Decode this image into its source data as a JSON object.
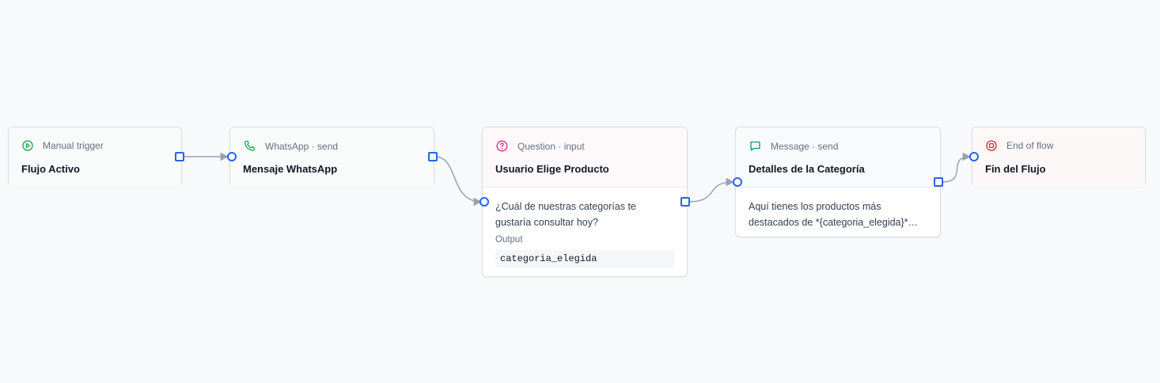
{
  "nodes": [
    {
      "id": "n1",
      "kind": "Manual trigger",
      "title": "Flujo Activo",
      "icon": "play-circle-icon",
      "accent": "#16a34a"
    },
    {
      "id": "n2",
      "kind": "WhatsApp · send",
      "title": "Mensaje WhatsApp",
      "icon": "phone-icon",
      "accent": "#16a34a"
    },
    {
      "id": "n3",
      "kind": "Question · input",
      "title": "Usuario Elige Producto",
      "icon": "question-circle-icon",
      "accent": "#db2777",
      "body": "¿Cuál de nuestras categorías te gustaría consultar hoy?",
      "output_label": "Output",
      "output_value": "categoria_elegida"
    },
    {
      "id": "n4",
      "kind": "Message · send",
      "title": "Detalles de la Categoría",
      "icon": "chat-bubble-icon",
      "accent": "#0d9488",
      "body": "Aquí tienes los productos más destacados de *{categoria_elegida}*…"
    },
    {
      "id": "n5",
      "kind": "End of flow",
      "title": "Fin del Flujo",
      "icon": "stop-circle-icon",
      "accent": "#dc2626"
    }
  ],
  "edges": [
    {
      "from": "n1",
      "to": "n2"
    },
    {
      "from": "n2",
      "to": "n3"
    },
    {
      "from": "n3",
      "to": "n4"
    },
    {
      "from": "n4",
      "to": "n5"
    }
  ],
  "colors": {
    "port": "#2563eb",
    "edge": "#98a2b3",
    "background": "#f8f9fb"
  }
}
